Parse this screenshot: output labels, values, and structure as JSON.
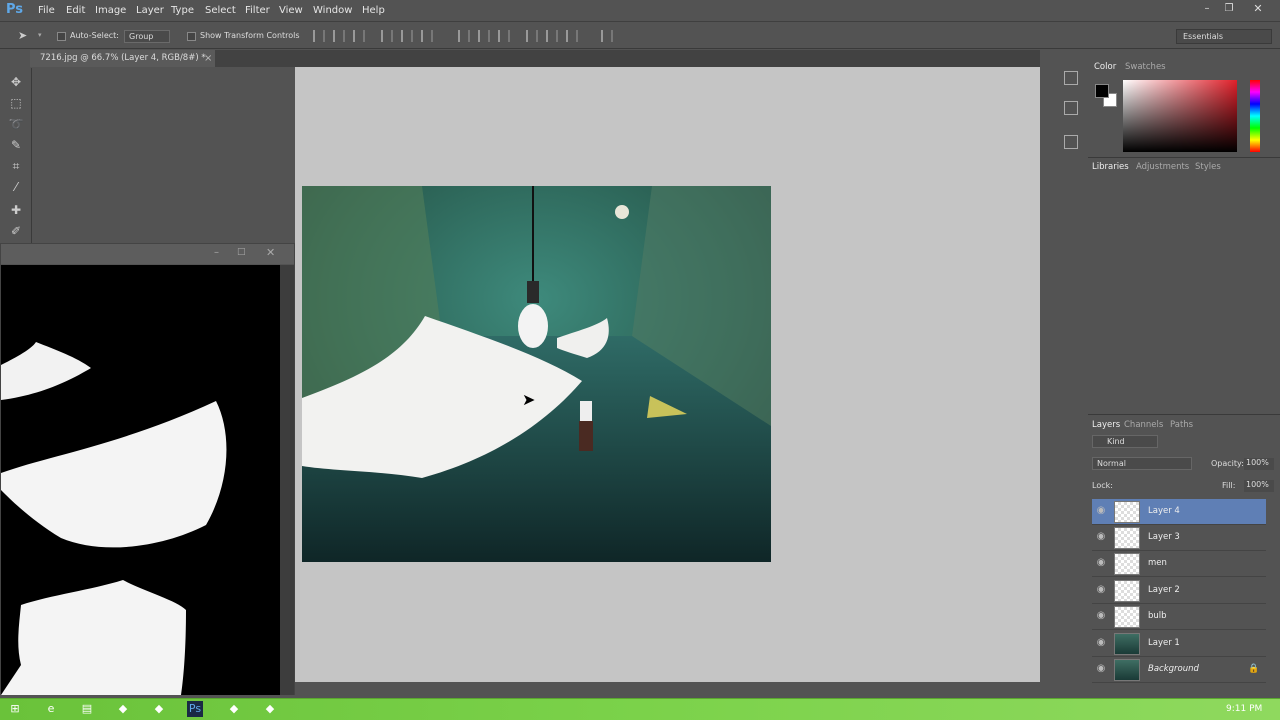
{
  "app": {
    "logo": "Ps"
  },
  "menu": [
    "File",
    "Edit",
    "Image",
    "Layer",
    "Type",
    "Select",
    "Filter",
    "View",
    "Window",
    "Help"
  ],
  "window_controls": {
    "minimize": "–",
    "maximize": "❐",
    "close": "✕"
  },
  "options": {
    "auto_select_label": "Auto-Select:",
    "auto_select_value": "Group",
    "transform_label": "Show Transform Controls",
    "workspace": "Essentials"
  },
  "document": {
    "tab_title": "7216.jpg @ 66.7% (Layer 4, RGB/8#) *",
    "close": "×"
  },
  "color_panel": {
    "tabs": [
      "Color",
      "Swatches"
    ],
    "fg": "#000000",
    "bg": "#ffffff"
  },
  "libs_panel": {
    "tabs": [
      "Libraries",
      "Adjustments",
      "Styles"
    ]
  },
  "layers_panel": {
    "tabs": [
      "Layers",
      "Channels",
      "Paths"
    ],
    "kind_label": "Kind",
    "blend_mode": "Normal",
    "opacity_label": "Opacity:",
    "opacity_value": "100%",
    "lock_label": "Lock:",
    "fill_label": "Fill:",
    "fill_value": "100%",
    "layers": [
      {
        "name": "Layer 4",
        "selected": true,
        "thumb": "transparent"
      },
      {
        "name": "Layer 3",
        "selected": false,
        "thumb": "transparent"
      },
      {
        "name": "men",
        "selected": false,
        "thumb": "transparent"
      },
      {
        "name": "Layer 2",
        "selected": false,
        "thumb": "transparent"
      },
      {
        "name": "bulb",
        "selected": false,
        "thumb": "transparent"
      },
      {
        "name": "Layer 1",
        "selected": false,
        "thumb": "image"
      },
      {
        "name": "Background",
        "selected": false,
        "thumb": "image"
      }
    ]
  },
  "taskbar": {
    "time": "9:11 PM"
  },
  "icons": [
    "move-icon",
    "marquee-icon",
    "lasso-icon",
    "brush-icon",
    "crop-icon",
    "eyedropper-icon",
    "healing-icon",
    "eye-icon",
    "lock-icon",
    "windows-start-icon"
  ]
}
